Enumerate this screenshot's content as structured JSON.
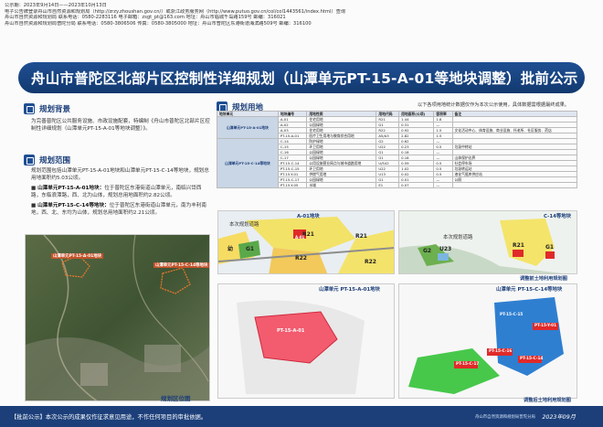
{
  "header": {
    "lines": [
      "公示期：2023年9月14日——2023年10月13日",
      "电子公告牌登录舟山市自然资源和规划局（http://zrzy.zhoushan.gov.cn/）或浙江政务服务网（http://www.putuo.gov.cn/col/col1443561/index.html）查询",
      "舟山市自然资源和规划局    联系电话：0580-2283116  电子邮箱：zsgt_pt@163.com   地址：舟山市临城千岛路159号   邮编：316021",
      "舟山市自然资源和规划局普陀分局    联系电话：0580-3806506  传真：0580-3805000  地址：舟山市普陀区东港街道海滨路509号   邮编：316100"
    ]
  },
  "banner_title": "舟山市普陀区北部片区控制性详细规划（山潭单元PT-15-A-01等地块调整）批前公示",
  "background": {
    "title": "规划背景",
    "paragraph": "为完善普陀区公共服务设施、市政设施配套，特编制《舟山市普陀区北部片区控制性详细规划（山潭单元PT-15-A-01等地块调整）》。"
  },
  "scope": {
    "title": "规划范围",
    "paragraph": "规划范围包括山潭单元PT-15-A-01地块和山潭单元PT-15-C-14等地块，规划总用地面积约5.03公顷。",
    "item1_label": "山潭单元PT-15-A-01地块：",
    "item1_text": "位于普陀区东港街道山潭单元，南临兴岱西路，东临浪潭路，西、北为山体，规划总用地面积约2.82公顷。",
    "item2_label": "山潭单元PT-15-C-14等地块：",
    "item2_text": "位于普陀区东港街道山潭单元，南为丰利南地，西、北、东均为山体，规划总用地面积约2.21公顷。"
  },
  "location_map": {
    "caption": "规划区位图",
    "label_a": "山潭单元PT-15-A-01地块",
    "label_c": "山潭单元PT-15-C-14等地块"
  },
  "land_use": {
    "title": "规划用地",
    "note": "以下各项用地统计数据仅作为本次公示使用，具体数据需根据最终成果。",
    "headers": [
      "地块单元",
      "地块编号",
      "用地性质",
      "用地代码",
      "用地面积(公顷)",
      "容积率",
      "备注"
    ],
    "group1": "山潭单元PT-15-A-01地块",
    "group2": "山潭单元PT-15-C-14等地块",
    "rows": [
      [
        "A-01",
        "住宅用地",
        "R21",
        "1.44",
        "1.8",
        ""
      ],
      [
        "A-02",
        "公园绿地",
        "G1",
        "0.31",
        "—",
        ""
      ],
      [
        "A-03",
        "住宅用地",
        "R22",
        "0.92",
        "1.5",
        "文化活动中心、体育设施、商业设施、托老所、社区服务、药店"
      ],
      [
        "PT-15-A-01",
        "医疗卫生用地与教育综合用地",
        "A5/A3",
        "2.82",
        "1.5",
        ""
      ],
      [
        "C-14",
        "防护绿地",
        "G2",
        "0.62",
        "—",
        ""
      ],
      [
        "C-15",
        "环卫用地",
        "U22",
        "0.23",
        "0.5",
        "垃圾中转站"
      ],
      [
        "C-16",
        "公园绿地",
        "G1",
        "0.18",
        "—",
        ""
      ],
      [
        "C-17",
        "公园绿地",
        "G1",
        "0.18",
        "—",
        "山体保护边界"
      ],
      [
        "PT-15-C-14",
        "公用设施营业网点与城市道路用地",
        "U/S42",
        "0.59",
        "0.5",
        "社会停车场"
      ],
      [
        "PT-15-C-15",
        "环卫用地",
        "U22",
        "1.02",
        "0.5",
        "垃圾转运站"
      ],
      [
        "PT-15-Y-01",
        "供燃气用地",
        "U13",
        "0.02",
        "0.5",
        "液化气瓶库供应站"
      ],
      [
        "PT-15-C-17",
        "公园绿地",
        "G1",
        "0.01",
        "—",
        "公厕"
      ],
      [
        "PT-15-Y-05",
        "水域",
        "E1",
        "0.07",
        "—",
        ""
      ]
    ]
  },
  "maps": {
    "a01_title": "A-01地块",
    "c14_title": "C-14等地块",
    "a01_road": "本次规划道路",
    "c14_road": "本次规划道路",
    "adjusted_caption": "调整前土地利用规划图",
    "after_a01_title": "山潭单元 PT-15-A-01地块",
    "after_c14_title": "山潭单元 PT-15-C-14等地块",
    "after_caption": "调整后土地利用规划图",
    "zones_a01": [
      "R21",
      "A-01",
      "G1",
      "R21",
      "R22",
      "A-03",
      "幼",
      "R22"
    ],
    "zones_c14": [
      "R21",
      "C-14",
      "G1",
      "Y-01",
      "G2",
      "U23",
      "C-15",
      "G1",
      "C-16"
    ],
    "after_a01_label": "PT-15-A-01",
    "after_c14_labels": [
      "PT-15-C-15",
      "PT-15-Y-01",
      "PT-15-C-16",
      "PT-15-C-17",
      "PT-15-C-14"
    ]
  },
  "footer": {
    "notice": "【批前公示】本次公示的成果仅作征求意见用途，不作任何项目的审批依据。",
    "logo_text": "舟山市自然资源和规划局普陀分局",
    "date": "2023年09月"
  }
}
